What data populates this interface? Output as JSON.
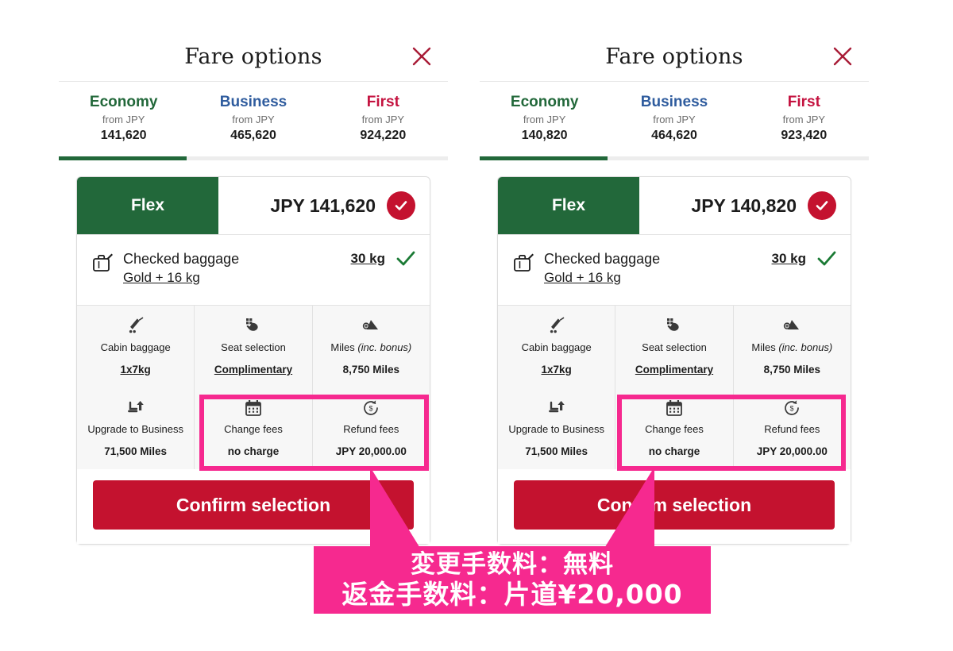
{
  "colors": {
    "green": "#22683a",
    "blue": "#2f5c9e",
    "red": "#c4122f",
    "crimson": "#a81b36",
    "pink": "#f6298f",
    "text": "#1c1c1c",
    "muted": "#6d6d6d"
  },
  "panels": [
    {
      "id": "left",
      "dialog": {
        "title": "Fare options",
        "close_icon": "close-x-icon"
      },
      "tabs": [
        {
          "name": "Economy",
          "from_label": "from JPY",
          "price": "141,620",
          "color": "#22683a",
          "active": true
        },
        {
          "name": "Business",
          "from_label": "from JPY",
          "price": "465,620",
          "color": "#2f5c9e",
          "active": false
        },
        {
          "name": "First",
          "from_label": "from JPY",
          "price": "924,220",
          "color": "#c4123f",
          "active": false
        }
      ],
      "card": {
        "tier": "Flex",
        "price": "JPY 141,620",
        "selected_icon": "check-circle-icon",
        "baggage": {
          "icon": "suitcase-tag-icon",
          "title": "Checked baggage",
          "subtitle": "Gold + 16 kg",
          "value": "30 kg",
          "tick_icon": "check-icon"
        },
        "features": [
          {
            "icon": "rolling-suitcase-icon",
            "label": "Cabin baggage",
            "value": "1x7kg",
            "underlined": true,
            "highlighted": false
          },
          {
            "icon": "hand-seat-select-icon",
            "label": "Seat selection",
            "value": "Complimentary",
            "underlined": true,
            "highlighted": false
          },
          {
            "icon": "airplane-tail-icon",
            "label": "Miles ",
            "label_italic": "(inc. bonus)",
            "value": "8,750 Miles",
            "underlined": false,
            "highlighted": false
          },
          {
            "icon": "seat-upgrade-icon",
            "label": "Upgrade to Business",
            "value": "71,500 Miles",
            "underlined": false,
            "highlighted": false
          },
          {
            "icon": "calendar-icon",
            "label": "Change fees",
            "value": "no charge",
            "underlined": false,
            "highlighted": true
          },
          {
            "icon": "refund-money-icon",
            "label": "Refund fees",
            "value": "JPY 20,000.00",
            "underlined": false,
            "highlighted": true
          }
        ],
        "confirm_label": "Confirm selection"
      }
    },
    {
      "id": "right",
      "dialog": {
        "title": "Fare options",
        "close_icon": "close-x-icon"
      },
      "tabs": [
        {
          "name": "Economy",
          "from_label": "from JPY",
          "price": "140,820",
          "color": "#22683a",
          "active": true
        },
        {
          "name": "Business",
          "from_label": "from JPY",
          "price": "464,620",
          "color": "#2f5c9e",
          "active": false
        },
        {
          "name": "First",
          "from_label": "from JPY",
          "price": "923,420",
          "color": "#c4123f",
          "active": false
        }
      ],
      "card": {
        "tier": "Flex",
        "price": "JPY 140,820",
        "selected_icon": "check-circle-icon",
        "baggage": {
          "icon": "suitcase-tag-icon",
          "title": "Checked baggage",
          "subtitle": "Gold + 16 kg",
          "value": "30 kg",
          "tick_icon": "check-icon"
        },
        "features": [
          {
            "icon": "rolling-suitcase-icon",
            "label": "Cabin baggage",
            "value": "1x7kg",
            "underlined": true,
            "highlighted": false
          },
          {
            "icon": "hand-seat-select-icon",
            "label": "Seat selection",
            "value": "Complimentary",
            "underlined": true,
            "highlighted": false
          },
          {
            "icon": "airplane-tail-icon",
            "label": "Miles ",
            "label_italic": "(inc. bonus)",
            "value": "8,750 Miles",
            "underlined": false,
            "highlighted": false
          },
          {
            "icon": "seat-upgrade-icon",
            "label": "Upgrade to Business",
            "value": "71,500 Miles",
            "underlined": false,
            "highlighted": false
          },
          {
            "icon": "calendar-icon",
            "label": "Change fees",
            "value": "no charge",
            "underlined": false,
            "highlighted": true
          },
          {
            "icon": "refund-money-icon",
            "label": "Refund fees",
            "value": "JPY 20,000.00",
            "underlined": false,
            "highlighted": true
          }
        ],
        "confirm_label": "Confirm selection"
      }
    }
  ],
  "annotation": {
    "line1": "変更手数料：無料",
    "line2": "返金手数料：片道¥20,000",
    "arrow_left_icon": "pointer-triangle-left-icon",
    "arrow_right_icon": "pointer-triangle-right-icon"
  }
}
